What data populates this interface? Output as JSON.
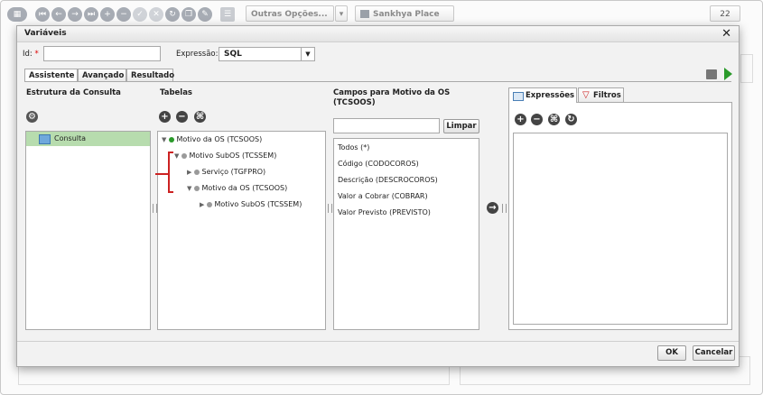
{
  "toolbar": {
    "outras_opcoes": "Outras Opções...",
    "sankhya_place": "Sankhya Place",
    "page_counter": "22"
  },
  "dialog": {
    "title": "Variáveis",
    "close": "✕",
    "id_label": "Id:",
    "id_required": "*",
    "id_value": "",
    "expressao_label": "Expressão:",
    "expressao_value": "SQL",
    "tabs": [
      "Assistente",
      "Avançado",
      "Resultado"
    ],
    "estrutura": {
      "title": "Estrutura da Consulta",
      "item": "Consulta"
    },
    "tabelas": {
      "title": "Tabelas",
      "tree": [
        "Motivo da OS (TCSOOS)",
        "Motivo SubOS (TCSSEM)",
        "Serviço (TGFPRO)",
        "Motivo da OS (TCSOOS)",
        "Motivo SubOS (TCSSEM)"
      ]
    },
    "campos": {
      "title": "Campos para Motivo da OS (TCSOOS)",
      "search_value": "",
      "limpar": "Limpar",
      "fields": [
        "Todos (*)",
        "Código (CODOCOROS)",
        "Descrição (DESCROCOROS)",
        "Valor a Cobrar (COBRAR)",
        "Valor Previsto (PREVISTO)"
      ]
    },
    "right_tabs": [
      "Expressões",
      "Filtros"
    ],
    "ok": "OK",
    "cancelar": "Cancelar"
  },
  "colors": {
    "selected_row": "#b7dcae",
    "tree_connector": "#cc2222",
    "play_green": "#2a9a2a"
  }
}
